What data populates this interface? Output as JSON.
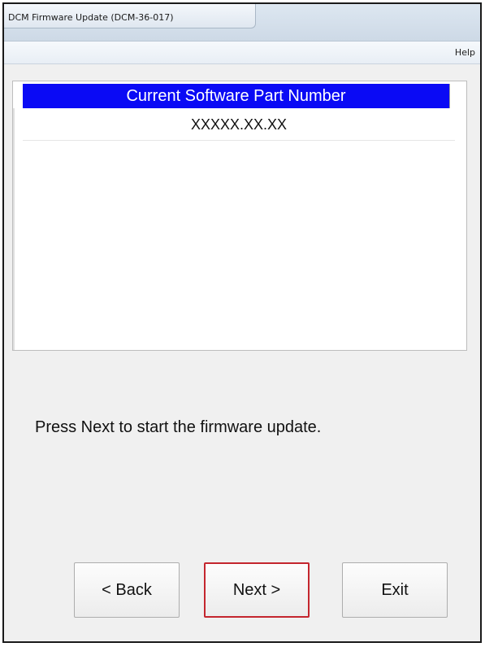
{
  "window": {
    "title": "DCM Firmware Update (DCM-36-017)"
  },
  "menubar": {
    "help_label": "Help"
  },
  "list": {
    "column_header": "Current Software Part Number",
    "value": "XXXXX.XX.XX"
  },
  "instruction_text": "Press Next to start the firmware update.",
  "buttons": {
    "back_label": "< Back",
    "next_label": "Next >",
    "exit_label": "Exit"
  },
  "colors": {
    "header_background": "#0a0af5",
    "header_text": "#ffffff",
    "next_button_highlight": "#c4262e",
    "dialog_background": "#f0f0f0"
  }
}
